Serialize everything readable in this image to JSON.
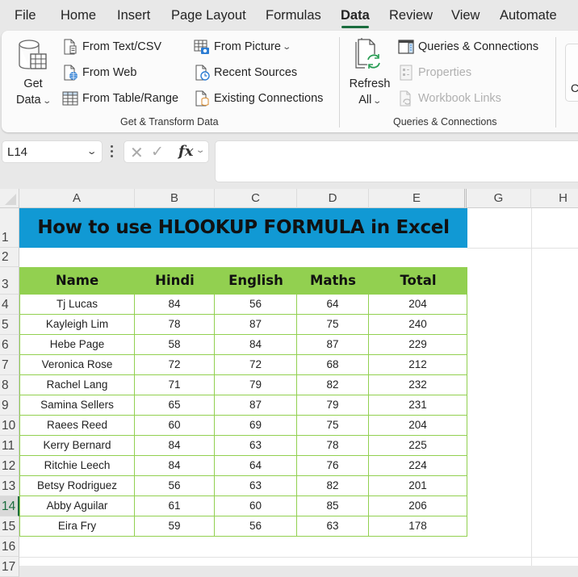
{
  "menu": {
    "tabs": [
      {
        "label": "File",
        "active": false
      },
      {
        "label": "Home",
        "active": false
      },
      {
        "label": "Insert",
        "active": false
      },
      {
        "label": "Page Layout",
        "active": false
      },
      {
        "label": "Formulas",
        "active": false
      },
      {
        "label": "Data",
        "active": true
      },
      {
        "label": "Review",
        "active": false
      },
      {
        "label": "View",
        "active": false
      },
      {
        "label": "Automate",
        "active": false
      }
    ]
  },
  "ribbon": {
    "get_transform": {
      "group_label": "Get & Transform Data",
      "get_data": {
        "line1": "Get",
        "line2": "Data",
        "icon": "database-table-icon"
      },
      "from_text_csv": {
        "label": "From Text/CSV",
        "icon": "text-file-icon"
      },
      "from_web": {
        "label": "From Web",
        "icon": "web-file-icon"
      },
      "from_table_range": {
        "label": "From Table/Range",
        "icon": "table-range-icon"
      },
      "from_picture": {
        "label": "From Picture",
        "icon": "picture-table-icon"
      },
      "recent_sources": {
        "label": "Recent Sources",
        "icon": "clock-file-icon"
      },
      "existing_connections": {
        "label": "Existing Connections",
        "icon": "connection-file-icon"
      }
    },
    "queries_connections": {
      "group_label": "Queries & Connections",
      "refresh_all": {
        "line1": "Refresh",
        "line2": "All",
        "icon": "refresh-icon"
      },
      "queries_connections_btn": {
        "label": "Queries & Connections",
        "icon": "pane-icon"
      },
      "properties": {
        "label": "Properties",
        "icon": "properties-icon",
        "disabled": true
      },
      "workbook_links": {
        "label": "Workbook Links",
        "icon": "link-file-icon",
        "disabled": true
      }
    },
    "partial_next_group_letter": "C"
  },
  "formula_bar": {
    "name_box": "L14",
    "cancel_icon": "✕",
    "enter_icon": "✓",
    "fx_label": "fx",
    "formula": ""
  },
  "sheet": {
    "columns": [
      "A",
      "B",
      "C",
      "D",
      "E",
      "G",
      "H"
    ],
    "rows": [
      "1",
      "2",
      "3",
      "4",
      "5",
      "6",
      "7",
      "8",
      "9",
      "10",
      "11",
      "12",
      "13",
      "14",
      "15",
      "16",
      "17"
    ],
    "selected_row": "14",
    "title": "How to use HLOOKUP FORMULA in Excel",
    "title_color": "#1199d4",
    "header_color": "#92d050",
    "headers": [
      "Name",
      "Hindi",
      "English",
      "Maths",
      "Total"
    ],
    "data": [
      [
        "Tj Lucas",
        "84",
        "56",
        "64",
        "204"
      ],
      [
        "Kayleigh Lim",
        "78",
        "87",
        "75",
        "240"
      ],
      [
        "Hebe Page",
        "58",
        "84",
        "87",
        "229"
      ],
      [
        "Veronica Rose",
        "72",
        "72",
        "68",
        "212"
      ],
      [
        "Rachel Lang",
        "71",
        "79",
        "82",
        "232"
      ],
      [
        "Samina Sellers",
        "65",
        "87",
        "79",
        "231"
      ],
      [
        "Raees Reed",
        "60",
        "69",
        "75",
        "204"
      ],
      [
        "Kerry Bernard",
        "84",
        "63",
        "78",
        "225"
      ],
      [
        "Ritchie Leech",
        "84",
        "64",
        "76",
        "224"
      ],
      [
        "Betsy Rodriguez",
        "56",
        "63",
        "82",
        "201"
      ],
      [
        "Abby Aguilar",
        "61",
        "60",
        "85",
        "206"
      ],
      [
        "Eira Fry",
        "59",
        "56",
        "63",
        "178"
      ]
    ]
  }
}
